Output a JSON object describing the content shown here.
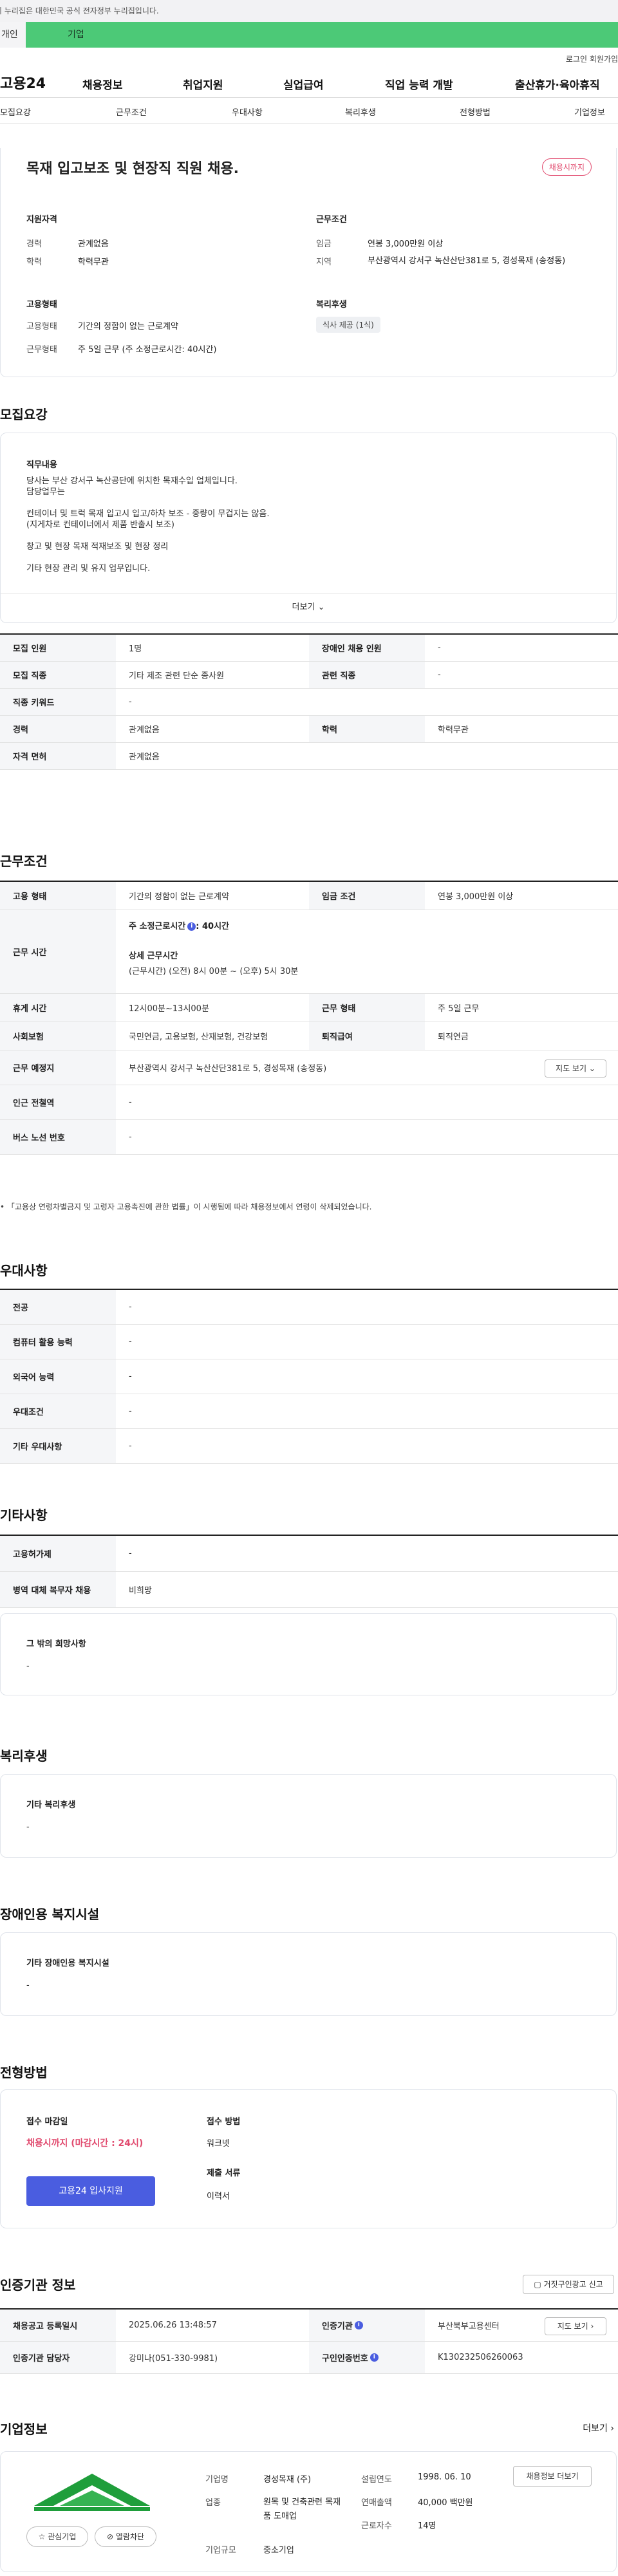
{
  "gov_banner": "이 누리집은 대한민국 공식 전자정부 누리집입니다.",
  "tabs": [
    "개인",
    "기업"
  ],
  "util": {
    "login": "로그인",
    "join": "회원가입"
  },
  "gnb": {
    "logo": "고용24",
    "menu": [
      "채용정보",
      "취업지원",
      "실업급여",
      "직업 능력 개발",
      "출산휴가·육아휴직"
    ]
  },
  "snb": [
    "모집요강",
    "근무조건",
    "우대사항",
    "복리후생",
    "전형방법",
    "기업정보"
  ],
  "summary": {
    "title": "목재 입고보조 및 현장직 직원 채용.",
    "status_badge": "채용시까지",
    "qual": {
      "heading": "지원자격",
      "rows": [
        {
          "k": "경력",
          "v": "관계없음"
        },
        {
          "k": "학력",
          "v": "학력무관"
        }
      ]
    },
    "cond": {
      "heading": "근무조건",
      "rows": [
        {
          "k": "임금",
          "v": "연봉 3,000만원 이상"
        },
        {
          "k": "지역",
          "v": "부산광역시 강서구 녹산산단381로 5, 경성목재 (송정동)"
        }
      ]
    },
    "emp": {
      "heading": "고용형태",
      "rows": [
        {
          "k": "고용형태",
          "v": "기간의 정함이 없는 근로계약"
        },
        {
          "k": "근무형태",
          "v": "주 5일 근무 (주 소정근로시간: 40시간)"
        }
      ]
    },
    "welfare": {
      "heading": "복리후생",
      "tag": "식사 제공 (1식)"
    }
  },
  "recruit": {
    "heading": "모집요강",
    "job_heading": "직무내용",
    "job_lines": [
      "당사는 부산 강서구 녹산공단에 위치한 목재수입 업체입니다.",
      "담당업무는",
      "",
      "컨테이너 및 트럭 목재 입고시 입고/하차 보조 - 중량이 무겁지는 않음.",
      "(지게차로 컨테이너에서 제품 반출시 보조)",
      "",
      "창고 및 현장 목재 적재보조 및 현장 정리",
      "",
      "기타 현장 관리 및 유지 업무입니다."
    ],
    "more": "더보기",
    "rows": [
      {
        "k1": "모집 인원",
        "v1": "1명",
        "k2": "장애인 채용 인원",
        "v2": "-"
      },
      {
        "k1": "모집 직종",
        "v1": "기타 제조 관련 단순 종사원",
        "k2": "관련 직종",
        "v2": "-"
      },
      {
        "k1": "직종 키워드",
        "v1": "-"
      },
      {
        "k1": "경력",
        "v1": "관계없음",
        "k2": "학력",
        "v2": "학력무관"
      },
      {
        "k1": "자격 면허",
        "v1": "관계없음"
      }
    ]
  },
  "work": {
    "heading": "근무조건",
    "emp_type_k": "고용 형태",
    "emp_type_v": "기간의 정함이 없는 근로계약",
    "wage_k": "임금 조건",
    "wage_v": "연봉 3,000만원 이상",
    "hours_k": "근무 시간",
    "hours_l1": "주 소정근로시간",
    "hours_l1b": ": 40시간",
    "hours_l2": "상세 근무시간",
    "hours_l3": "(근무시간) (오전) 8시 00분 ~ (오후) 5시 30분",
    "rest_k": "휴게 시간",
    "rest_v": "12시00분~13시00분",
    "form_k": "근무 형태",
    "form_v": "주 5일 근무",
    "ins_k": "사회보험",
    "ins_v": "국민연금, 고용보험, 산재보험, 건강보험",
    "ret_k": "퇴직급여",
    "ret_v": "퇴직연금",
    "loc_k": "근무 예정지",
    "loc_v": "부산광역시 강서구 녹산산단381로 5, 경성목재 (송정동)",
    "map_btn": "지도 보기",
    "sub_k": "인근 전철역",
    "sub_v": "-",
    "bus_k": "버스 노선 번호",
    "bus_v": "-",
    "note": "「고용상 연령차별금지 및 고령자 고용촉진에 관한 법률」이 시행됨에 따라 채용정보에서 연령이 삭제되었습니다."
  },
  "pref": {
    "heading": "우대사항",
    "rows": [
      {
        "k": "전공",
        "v": "-"
      },
      {
        "k": "컴퓨터 활용 능력",
        "v": "-"
      },
      {
        "k": "외국어 능력",
        "v": "-"
      },
      {
        "k": "우대조건",
        "v": "-"
      },
      {
        "k": "기타 우대사항",
        "v": "-"
      }
    ]
  },
  "etc": {
    "heading": "기타사항",
    "rows": [
      {
        "k": "고용허가제",
        "v": "-"
      },
      {
        "k": "병역 대체 복무자 채용",
        "v": "비희망"
      }
    ],
    "box_title": "그 밖의 희망사항",
    "box_val": "-"
  },
  "benefit": {
    "heading": "복리후생",
    "box_title": "기타 복리후생",
    "box_val": "-"
  },
  "disabled": {
    "heading": "장애인용 복지시설",
    "box_title": "기타 장애인용 복지시설",
    "box_val": "-"
  },
  "process": {
    "heading": "전형방법",
    "deadline_k": "접수 마감일",
    "deadline_v": "채용시까지 (마감시간 : 24시)",
    "apply_btn": "고용24 입사지원",
    "method_k": "접수 방법",
    "method_v": "워크넷",
    "docs_k": "제출 서류",
    "docs_v": "이력서"
  },
  "cert": {
    "heading": "인증기관 정보",
    "report_btn": "거짓구인광고 신고",
    "reg_k": "채용공고 등록일시",
    "reg_v": "2025.06.26 13:48:57",
    "org_k": "인증기관",
    "org_v": "부산북부고용센터",
    "map_btn": "지도 보기",
    "mgr_k": "인증기관 담당자",
    "mgr_v": "강미나(051-330-9981)",
    "no_k": "구인인증번호",
    "no_v": "K130232506260063"
  },
  "company": {
    "heading": "기업정보",
    "more": "더보기",
    "rows_left": [
      {
        "k": "기업명",
        "v": "경성목재 (주)"
      },
      {
        "k": "업종",
        "v": "원목 및 건축관련 목재품 도매업"
      },
      {
        "k": "기업규모",
        "v": "중소기업"
      }
    ],
    "rows_right": [
      {
        "k": "설립연도",
        "v": "1998. 06. 10"
      },
      {
        "k": "연매출액",
        "v": "40,000 백만원"
      },
      {
        "k": "근로자수",
        "v": "14명"
      }
    ],
    "btn_info": "채용정보 더보기",
    "btn_fav": "관심기업",
    "btn_block": "열람차단"
  },
  "colors": {
    "accent": "#4a5de0",
    "green": "#4cc977",
    "status": "#e14a6e"
  }
}
